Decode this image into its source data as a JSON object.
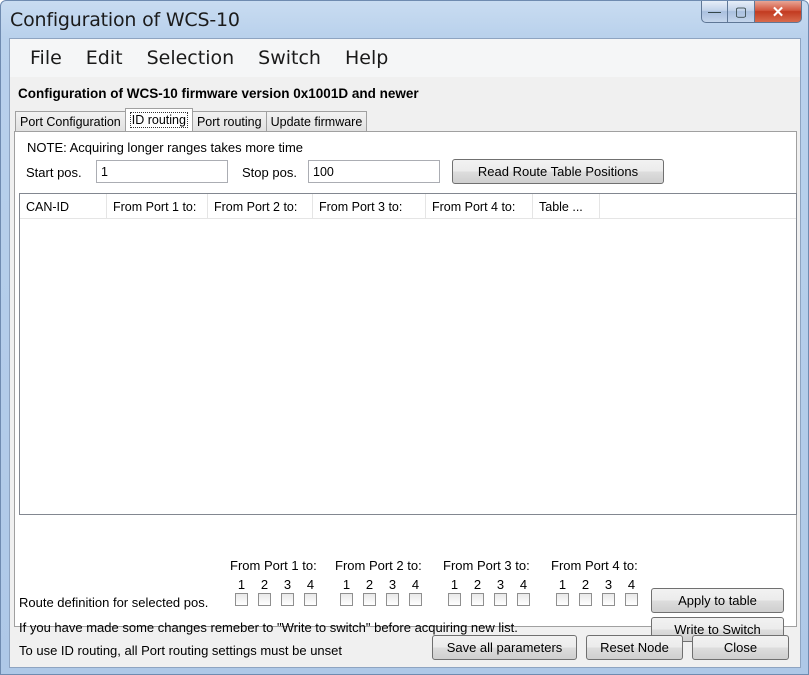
{
  "window": {
    "title": "Configuration of WCS-10",
    "min_glyph": "—",
    "max_glyph": "▢",
    "close_glyph": "✕"
  },
  "menu": [
    "File",
    "Edit",
    "Selection",
    "Switch",
    "Help"
  ],
  "heading": "Configuration of WCS-10 firmware version 0x1001D and newer",
  "tabs": [
    "Port Configuration",
    "ID routing",
    "Port routing",
    "Update firmware"
  ],
  "active_tab": "ID routing",
  "id_routing": {
    "note": "NOTE: Acquiring longer ranges takes more time",
    "start_label": "Start pos.",
    "start_value": "1",
    "stop_label": "Stop pos.",
    "stop_value": "100",
    "read_button": "Read Route Table Positions",
    "columns": [
      "CAN-ID",
      "From Port 1 to:",
      "From Port 2 to:",
      "From Port 3 to:",
      "From Port 4 to:",
      "Table ..."
    ],
    "route_label": "Route definition for selected pos.",
    "port_groups": [
      {
        "title": "From Port 1 to:",
        "nums": [
          "1",
          "2",
          "3",
          "4"
        ]
      },
      {
        "title": "From Port 2 to:",
        "nums": [
          "1",
          "2",
          "3",
          "4"
        ]
      },
      {
        "title": "From Port 3 to:",
        "nums": [
          "1",
          "2",
          "3",
          "4"
        ]
      },
      {
        "title": "From Port 4 to:",
        "nums": [
          "1",
          "2",
          "3",
          "4"
        ]
      }
    ],
    "apply_button": "Apply to table",
    "write_button": "Write to Switch",
    "info1": "If you have made some changes remeber to \"Write to switch\" before acquiring new list.",
    "info2": "To use ID routing, all Port routing settings must be unset"
  },
  "footer": {
    "save_button": "Save all parameters",
    "reset_button": "Reset Node",
    "close_button": "Close"
  }
}
